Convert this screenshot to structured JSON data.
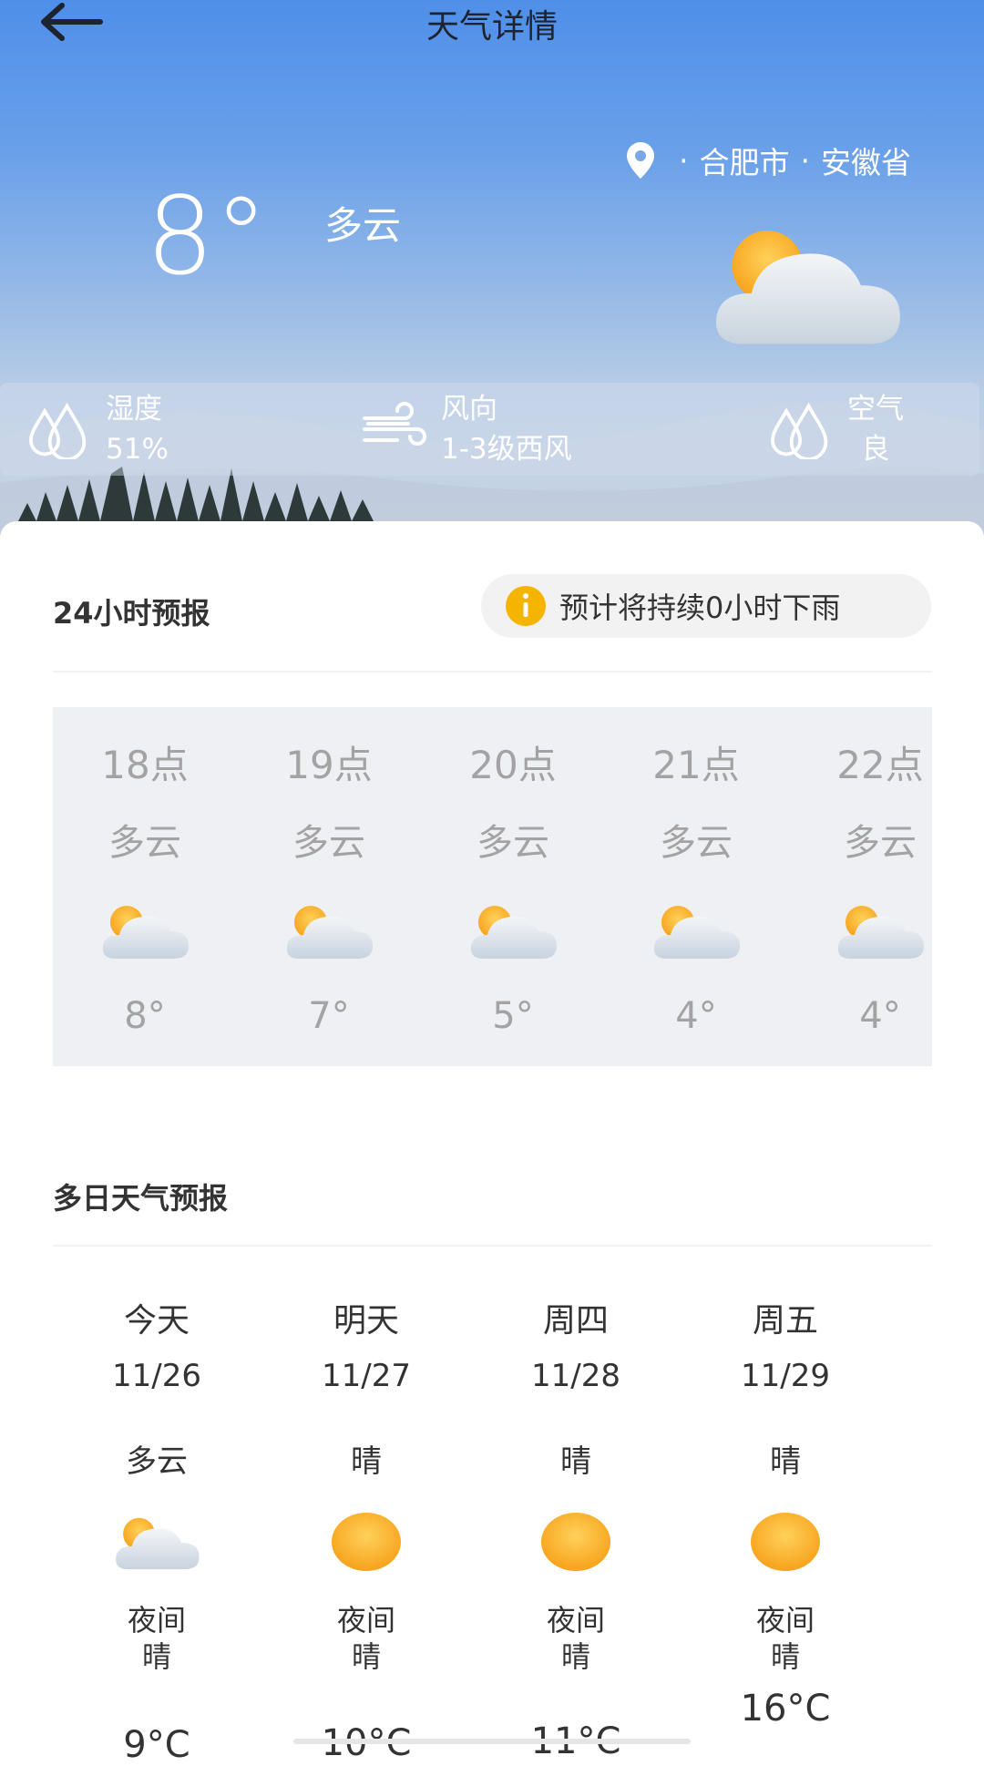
{
  "header": {
    "title": "天气详情"
  },
  "location": {
    "city": "合肥市",
    "province": "安徽省",
    "separator": "·"
  },
  "current": {
    "temperature": "8°",
    "condition": "多云"
  },
  "info_bar": {
    "humidity": {
      "label": "湿度",
      "value": "51%"
    },
    "wind": {
      "label": "风向",
      "value": "1-3级西风"
    },
    "air": {
      "label": "空气",
      "value": "良"
    }
  },
  "hourly": {
    "title": "24小时预报",
    "rain_notice": "预计将持续0小时下雨",
    "items": [
      {
        "time": "18点",
        "condition": "多云",
        "icon": "partly-cloudy-icon",
        "temp": "8°"
      },
      {
        "time": "19点",
        "condition": "多云",
        "icon": "partly-cloudy-icon",
        "temp": "7°"
      },
      {
        "time": "20点",
        "condition": "多云",
        "icon": "partly-cloudy-icon",
        "temp": "5°"
      },
      {
        "time": "21点",
        "condition": "多云",
        "icon": "partly-cloudy-icon",
        "temp": "4°"
      },
      {
        "time": "22点",
        "condition": "多云",
        "icon": "partly-cloudy-icon",
        "temp": "4°"
      }
    ]
  },
  "daily": {
    "title": "多日天气预报",
    "items": [
      {
        "name": "今天",
        "date": "11/26",
        "condition": "多云",
        "icon": "partly-cloudy-icon",
        "night_label": "夜间",
        "night_condition": "晴",
        "temp": "9°C"
      },
      {
        "name": "明天",
        "date": "11/27",
        "condition": "晴",
        "icon": "sun-icon",
        "night_label": "夜间",
        "night_condition": "晴",
        "temp": "10°C"
      },
      {
        "name": "周四",
        "date": "11/28",
        "condition": "晴",
        "icon": "sun-icon",
        "night_label": "夜间",
        "night_condition": "晴",
        "temp": "11°C"
      },
      {
        "name": "周五",
        "date": "11/29",
        "condition": "晴",
        "icon": "sun-icon",
        "night_label": "夜间",
        "night_condition": "晴",
        "temp": "16°C"
      }
    ]
  },
  "colors": {
    "accent_sun": "#f7a21b",
    "hero_top": "#4f8fe9",
    "notice_icon": "#f5b400"
  }
}
